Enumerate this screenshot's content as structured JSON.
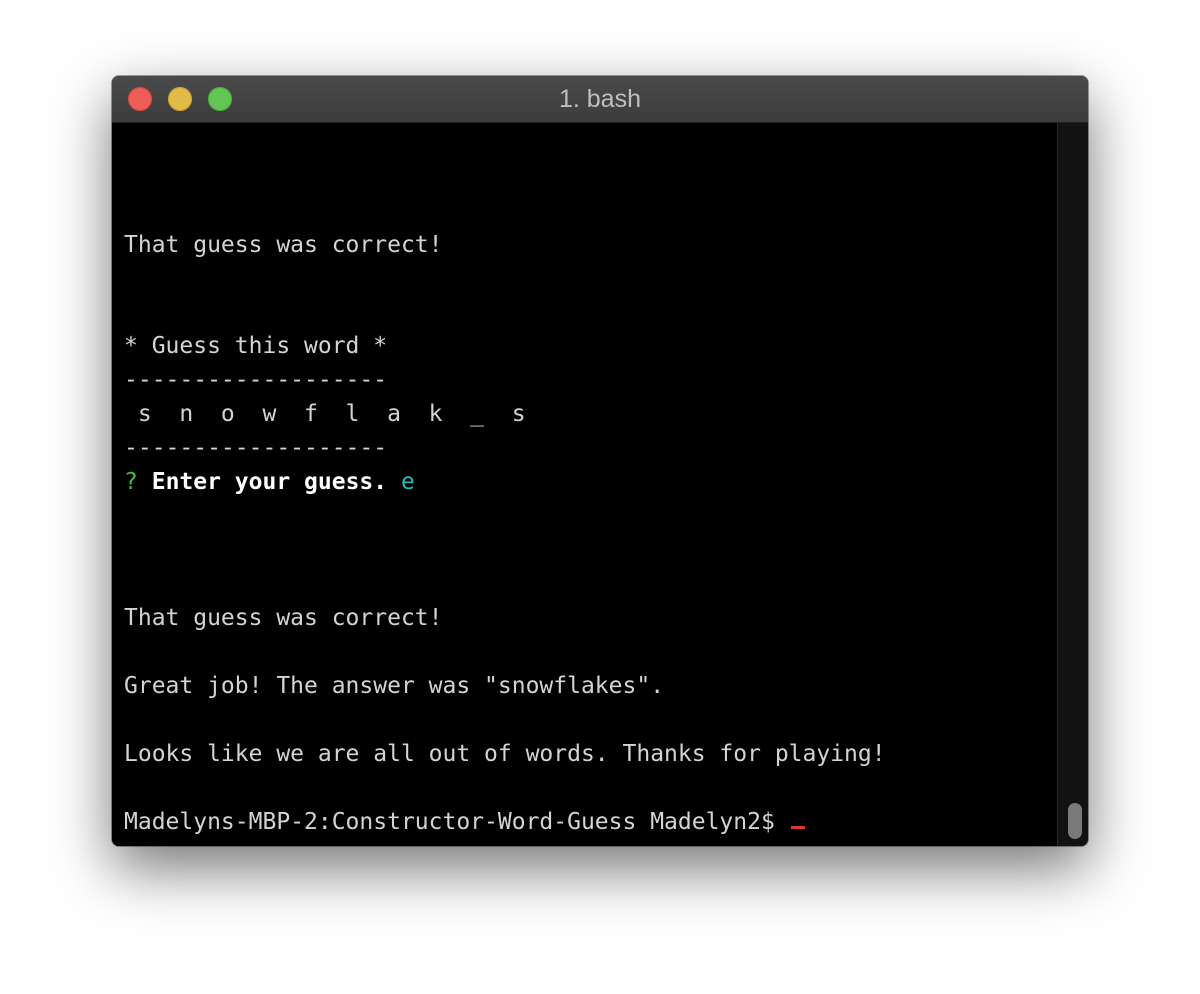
{
  "window": {
    "title": "1. bash"
  },
  "terminal": {
    "line1": "That guess was correct!",
    "line2": "* Guess this word *",
    "divider1": "-------------------",
    "word": " s  n  o  w  f  l  a  k  _  s",
    "divider2": "-------------------",
    "prompt_mark": "?",
    "prompt_text": "Enter your guess.",
    "prompt_answer": "e",
    "line3": "That guess was correct!",
    "line4": "Great job! The answer was \"snowflakes\".",
    "line5": "Looks like we are all out of words. Thanks for playing!",
    "shell_prompt": "Madelyns-MBP-2:Constructor-Word-Guess Madelyn2$ "
  }
}
